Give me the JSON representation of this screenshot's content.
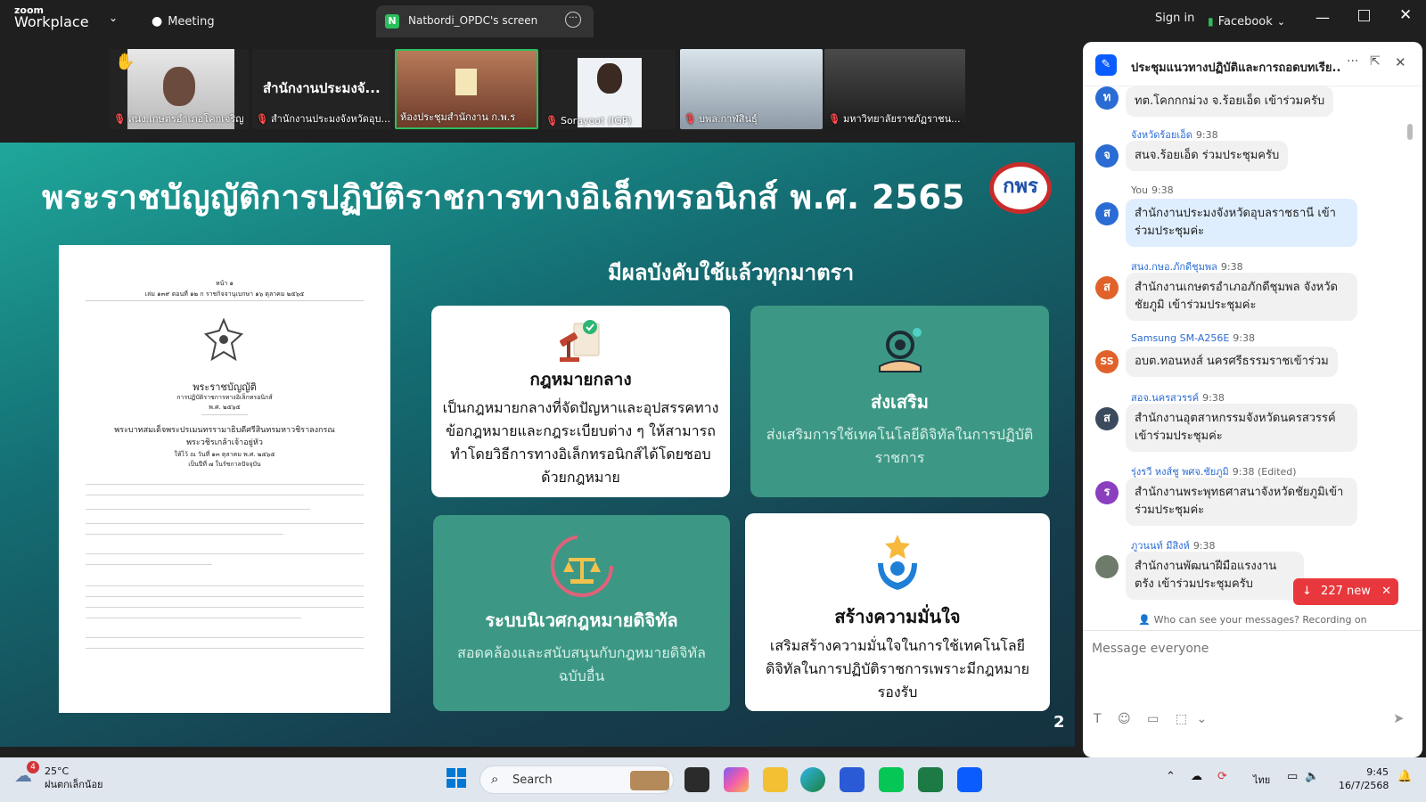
{
  "app": {
    "brand_top": "zoom",
    "brand_bottom": "Workplace",
    "meeting_label": "Meeting",
    "share_tab": "Natbordi_OPDC's screen",
    "share_badge": "N",
    "sign_in": "Sign in",
    "facebook": "Facebook"
  },
  "participants": [
    {
      "name": "สนง.เกษตรอำเภอโคกเจริญ"
    },
    {
      "name": "สำนักงานประมงจังหวัดอุบ...",
      "big_name": "สำนักงานประมงจั..."
    },
    {
      "name": "ห้องประชุมสำนักงาน ก.พ.ร"
    },
    {
      "name": "Sorayoot (IGP)"
    },
    {
      "name": "บพล.กาฬสินธุ์"
    },
    {
      "name": "มหาวิทยาลัยราชภัฏราชน..."
    }
  ],
  "slide": {
    "title": "พระราชบัญญัติการปฏิบัติราชการทางอิเล็กทรอนิกส์ พ.ศ. 2565",
    "logo": "กพร",
    "subtitle": "มีผลบังคับใช้แล้วทุกมาตรา",
    "page_number": "2",
    "doc": {
      "header": "หน้า ๑",
      "meta": "เล่ม ๑๓๙ ตอนที่ ๑๒ ก   ราชกิจจานุเบกษา   ๑๖ ตุลาคม ๒๕๖๕",
      "act": "พระราชบัญญัติ",
      "act_sub": "การปฏิบัติราชการทางอิเล็กทรอนิกส์",
      "year": "พ.ศ. ๒๕๖๕",
      "king1": "พระบาทสมเด็จพระปรเมนทรรามาธิบดีศรีสินทรมหาวชิราลงกรณ",
      "king2": "พระวชิรเกล้าเจ้าอยู่หัว",
      "given": "ให้ไว้ ณ วันที่ ๑๓ ตุลาคม พ.ศ. ๒๕๖๕",
      "given2": "เป็นปีที่ ๗ ในรัชกาลปัจจุบัน"
    },
    "cards": [
      {
        "title": "กฎหมายกลาง",
        "body": "เป็นกฎหมายกลางที่จัดปัญหาและอุปสรรคทางข้อกฎหมายและกฎระเบียบต่าง ๆ ให้สามารถทำโดยวิธีการทางอิเล็กทรอนิกส์ได้โดยชอบด้วยกฎหมาย"
      },
      {
        "title": "ส่งเสริม",
        "body": "ส่งเสริมการใช้เทคโนโลยีดิจิทัลในการปฏิบัติราชการ"
      },
      {
        "title": "ระบบนิเวศกฎหมายดิจิทัล",
        "body": "สอดคล้องและสนับสนุนกับกฎหมายดิจิทัลฉบับอื่น"
      },
      {
        "title": "สร้างความมั่นใจ",
        "body": "เสริมสร้างความมั่นใจในการใช้เทคโนโลยีดิจิทัลในการปฏิบัติราชการเพราะมีกฎหมายรองรับ"
      }
    ]
  },
  "chat": {
    "title": "ประชุมแนวทางปฏิบัติและการถอดบทเรีย...",
    "messages": [
      {
        "avatar": "ท",
        "sender": "",
        "time": "",
        "text": "ทต.โคกกกม่วง จ.ร้อยเอ็ด เข้าร่วมครับ"
      },
      {
        "avatar": "จ",
        "sender": "จังหวัดร้อยเอ็ด",
        "time": "9:38",
        "text": "สนจ.ร้อยเอ็ด ร่วมประชุมครับ"
      },
      {
        "avatar": "ส",
        "sender": "You",
        "time": "9:38",
        "text": "สำนักงานประมงจังหวัดอุบลราชธานี เข้าร่วมประชุมค่ะ"
      },
      {
        "avatar": "ส",
        "sender": "สนง.กษอ.ภักดีชุมพล",
        "time": "9:38",
        "text": "สำนักงานเกษตรอำเภอภักดีชุมพล จังหวัดชัยภูมิ เข้าร่วมประชุมค่ะ"
      },
      {
        "avatar": "SS",
        "sender": "Samsung SM-A256E",
        "time": "9:38",
        "text": "อบต.ทอนหงส์ นครศรีธรรมราชเข้าร่วม"
      },
      {
        "avatar": "ส",
        "sender": "สอจ.นครสวรรค์",
        "time": "9:38",
        "text": "สำนักงานอุตสาหกรรมจังหวัดนครสวรรค์ เข้าร่วมประชุมค่ะ"
      },
      {
        "avatar": "ร",
        "sender": "รุ่งรวี หงส์ชู พศจ.ชัยภูมิ",
        "time": "9:38 (Edited)",
        "text": "สำนักงานพระพุทธศาสนาจังหวัดชัยภูมิเข้าร่วมประชุมค่ะ"
      },
      {
        "avatar": "",
        "sender": "ภูวนนท์ มีสิงห์",
        "time": "9:38",
        "text": "สำนักงานพัฒนาฝีมือแรงงานตรัง เข้าร่วมประชุมครับ"
      }
    ],
    "new_badge": "227 new",
    "privacy": "Who can see your messages? Recording on",
    "input_placeholder": "Message everyone"
  },
  "taskbar": {
    "weather_temp": "25°C",
    "weather_desc": "ฝนตกเล็กน้อย",
    "weather_badge": "4",
    "search": "Search",
    "lang": "ไทย",
    "time": "9:45",
    "date": "16/7/2568"
  },
  "colors": {
    "slide_teal": "#1fa79a",
    "card_teal": "#3c9884",
    "zoom_blue": "#0b5cff",
    "chat_link": "#2b6cd4",
    "highlight_green": "#2bbf5c",
    "new_badge": "#e8383d"
  }
}
